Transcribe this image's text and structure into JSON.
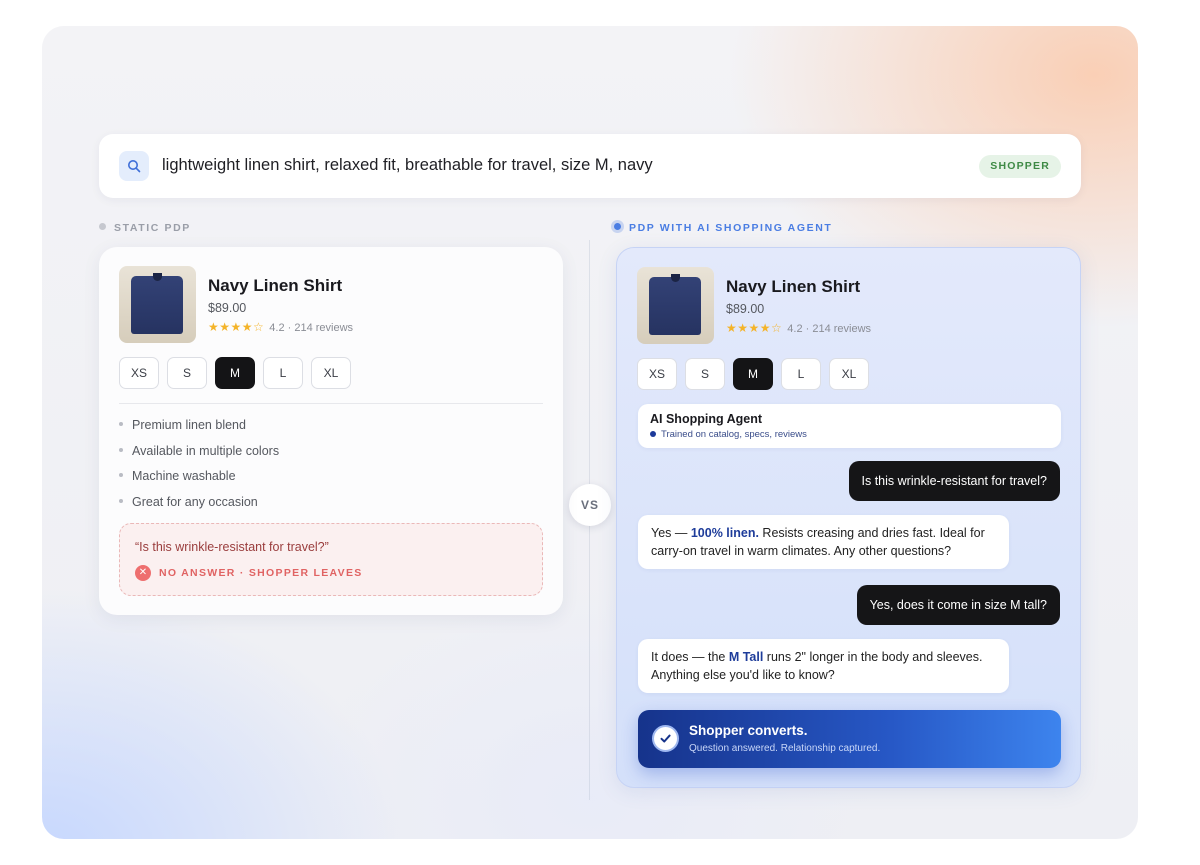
{
  "search": {
    "query": "lightweight linen shirt, relaxed fit, breathable for travel, size M, navy",
    "badge": "SHOPPER",
    "icon": "search-icon"
  },
  "labels": {
    "left": "STATIC PDP",
    "right": "PDP WITH AI SHOPPING AGENT",
    "vs": "VS"
  },
  "product": {
    "name": "Navy Linen Shirt",
    "price": "$89.00",
    "stars": "★★★★☆",
    "rating_text": "4.2 · 214 reviews",
    "rating_value": 4.2,
    "sizes": [
      "XS",
      "S",
      "M",
      "L",
      "XL"
    ],
    "selected_size": "M"
  },
  "static_pdp": {
    "bullets": [
      "Premium linen blend",
      "Available in multiple colors",
      "Machine washable",
      "Great for any occasion"
    ],
    "question": "“Is this wrinkle-resistant for travel?”",
    "no_answer": "NO ANSWER · SHOPPER LEAVES"
  },
  "agent_pdp": {
    "agent_title": "AI Shopping Agent",
    "agent_subtitle": "Trained on catalog, specs, reviews",
    "messages": [
      {
        "role": "user",
        "text": "Is this wrinkle-resistant for travel?"
      },
      {
        "role": "bot",
        "pre": "Yes — ",
        "bold": "100% linen.",
        "post": " Resists creasing and dries fast. Ideal for carry-on travel in warm climates. Any other questions?"
      },
      {
        "role": "user",
        "text": "Yes, does it come in size M tall?"
      },
      {
        "role": "bot",
        "pre": "It does — the ",
        "bold": "M Tall",
        "post": " runs 2\" longer in the body and sleeves. Anything else you'd like to know?"
      }
    ],
    "convert_title": "Shopper converts.",
    "convert_subtitle": "Question answered. Relationship captured."
  },
  "colors": {
    "accent_blue": "#4a7de3",
    "convert_dark": "#16338b",
    "convert_light": "#3d84ee",
    "error_red": "#e06363",
    "success_green": "#3e8a45",
    "star_gold": "#f4b42a"
  }
}
